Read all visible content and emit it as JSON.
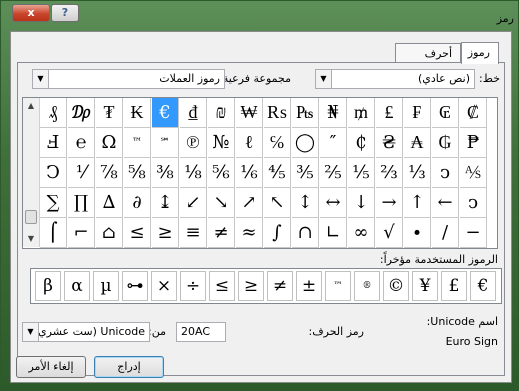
{
  "window": {
    "title": "رمز",
    "close_label": "x",
    "help_label": "?"
  },
  "tabs": [
    {
      "label": "رموز"
    },
    {
      "label": "أحرف خاصة"
    }
  ],
  "font": {
    "label": "خط:",
    "value": "(نص عادي)"
  },
  "subset": {
    "label": "مجموعة فرعية:",
    "value": "رموز العملات"
  },
  "symbols": [
    [
      "₰",
      "₯",
      "₮",
      "₭",
      "€",
      "₫",
      "₪",
      "₩",
      "₨",
      "₧",
      "₦",
      "₥",
      "₤",
      "₣",
      "₢",
      "₡"
    ],
    [
      "Ⅎ",
      "℮",
      "Ω",
      "™",
      "℠",
      "℗",
      "№",
      "ℓ",
      "℅",
      "◯",
      "″",
      "₵",
      "₴",
      "₳",
      "₲",
      "₱"
    ],
    [
      "Ↄ",
      "⅟",
      "⅞",
      "⅝",
      "⅜",
      "⅛",
      "⅚",
      "⅙",
      "⅘",
      "⅗",
      "⅖",
      "⅕",
      "⅔",
      "⅓",
      "ↄ",
      "⅍"
    ],
    [
      "∑",
      "∏",
      "∆",
      "∂",
      "↨",
      "↙",
      "↘",
      "↗",
      "↖",
      "↕",
      "↔",
      "↓",
      "→",
      "↑",
      "←",
      "ↄ"
    ],
    [
      "⌠",
      "⌐",
      "⌂",
      "≤",
      "≥",
      "≡",
      "≠",
      "≈",
      "∫",
      "∩",
      "∟",
      "∞",
      "√",
      "∙",
      "/",
      "−"
    ]
  ],
  "selected_symbol": "€",
  "recent": {
    "label": "الرموز المستخدمة مؤخراً:",
    "items": [
      "β",
      "α",
      "µ",
      "⊶",
      "×",
      "÷",
      "≤",
      "≥",
      "≠",
      "±",
      "™",
      "®",
      "©",
      "¥",
      "£",
      "€"
    ]
  },
  "unicode_name": {
    "label": "اسم Unicode:",
    "value": "Euro Sign"
  },
  "char_code": {
    "label": "رمز الحرف:",
    "value": "20AC"
  },
  "from": {
    "label": "من:",
    "value": "Unicode (ست عشري)"
  },
  "buttons": {
    "insert": "إدراج",
    "cancel": "إلغاء الأمر"
  }
}
